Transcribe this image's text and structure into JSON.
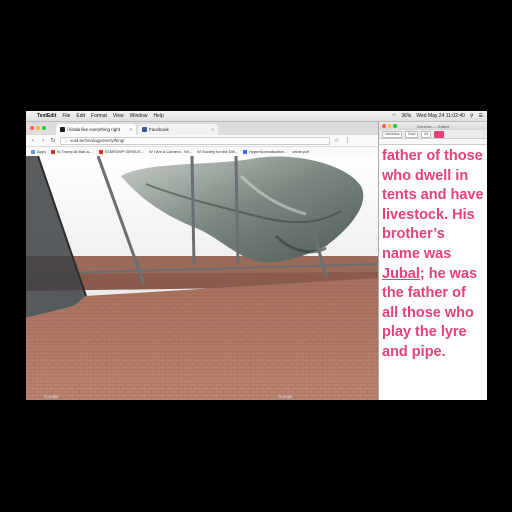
{
  "menubar": {
    "app": "TextEdit",
    "items": [
      "File",
      "Edit",
      "Format",
      "View",
      "Window",
      "Help"
    ],
    "clock": "Wed May 24  11:02:40",
    "battery": "36%"
  },
  "browser": {
    "tabs": [
      {
        "title": "i kinda like everything right",
        "favicon_color": "#1a1a1a"
      },
      {
        "title": "Facebook",
        "favicon_color": "#3b5998"
      }
    ],
    "url": "void.technology/everything/",
    "bookmarks": [
      "Apps",
      "Is Trump At Mar-a-...",
      "STARSHIP GENIUS...",
      "W I Am a Camera - Wi...",
      "W Society for the Diff...",
      "HyperNormalisation...",
      "zanie.pdf"
    ],
    "watermarks": [
      "Google",
      "Google"
    ]
  },
  "textedit": {
    "window_title": "Genesis — Edited",
    "font_menu": "Helvetica",
    "style_menu": "Bold",
    "size_menu": "64",
    "text_before": "father of those who dwell in tents and have livestock. His brother’s name was ",
    "text_underlined": "Jubal",
    "text_after": "; he was the father of all those who play the lyre and pipe."
  }
}
